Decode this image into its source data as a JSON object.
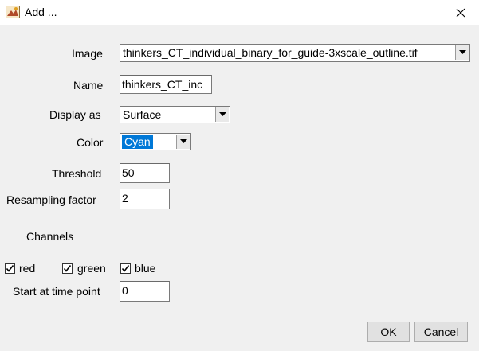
{
  "window": {
    "title": "Add ...",
    "app_icon": "imagej-icon",
    "close_icon": "close-icon"
  },
  "form": {
    "image": {
      "label": "Image",
      "value": "thinkers_CT_individual_binary_for_guide-3xscale_outline.tif"
    },
    "name": {
      "label": "Name",
      "value": "thinkers_CT_inc"
    },
    "display_as": {
      "label": "Display as",
      "value": "Surface"
    },
    "color": {
      "label": "Color",
      "value": "Cyan"
    },
    "threshold": {
      "label": "Threshold",
      "value": "50"
    },
    "resampling": {
      "label": "Resampling factor",
      "value": "2"
    },
    "channels": {
      "label": "Channels",
      "red": {
        "label": "red",
        "checked": true
      },
      "green": {
        "label": "green",
        "checked": true
      },
      "blue": {
        "label": "blue",
        "checked": true
      }
    },
    "start_time": {
      "label": "Start at time point",
      "value": "0"
    }
  },
  "buttons": {
    "ok": "OK",
    "cancel": "Cancel"
  }
}
